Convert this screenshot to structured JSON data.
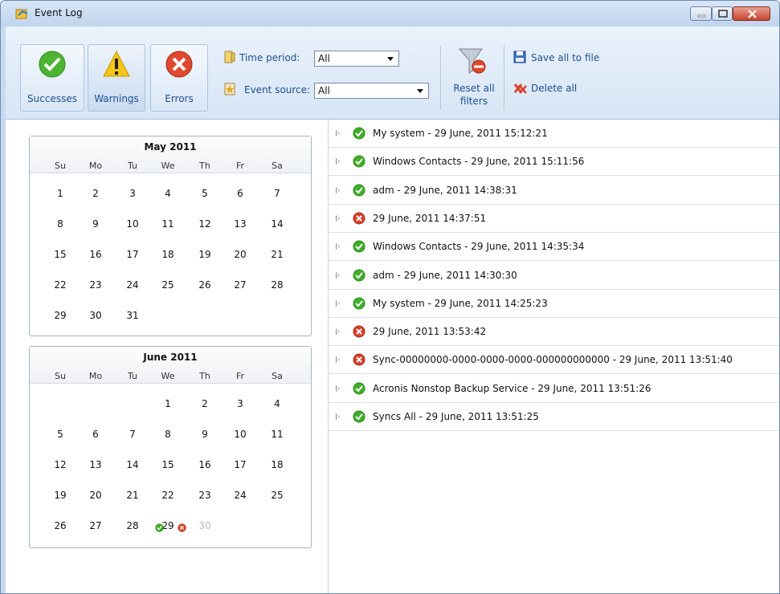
{
  "window": {
    "title": "Event Log"
  },
  "toolbar": {
    "successes_label": "Successes",
    "warnings_label": "Warnings",
    "errors_label": "Errors",
    "time_period_label": "Time period:",
    "time_period_value": "All",
    "event_source_label": "Event source:",
    "event_source_value": "All",
    "reset_line1": "Reset all",
    "reset_line2": "filters",
    "save_label": "Save all to file",
    "delete_label": "Delete all"
  },
  "calendars": [
    {
      "title": "May 2011",
      "dow": [
        "Su",
        "Mo",
        "Tu",
        "We",
        "Th",
        "Fr",
        "Sa"
      ],
      "rows": [
        [
          "1",
          "2",
          "3",
          "4",
          "5",
          "6",
          "7"
        ],
        [
          "8",
          "9",
          "10",
          "11",
          "12",
          "13",
          "14"
        ],
        [
          "15",
          "16",
          "17",
          "18",
          "19",
          "20",
          "21"
        ],
        [
          "22",
          "23",
          "24",
          "25",
          "26",
          "27",
          "28"
        ],
        [
          "29",
          "30",
          "31",
          "",
          "",
          "",
          ""
        ]
      ]
    },
    {
      "title": "June 2011",
      "dow": [
        "Su",
        "Mo",
        "Tu",
        "We",
        "Th",
        "Fr",
        "Sa"
      ],
      "rows": [
        [
          "",
          "",
          "",
          "1",
          "2",
          "3",
          "4"
        ],
        [
          "5",
          "6",
          "7",
          "8",
          "9",
          "10",
          "11"
        ],
        [
          "12",
          "13",
          "14",
          "15",
          "16",
          "17",
          "18"
        ],
        [
          "19",
          "20",
          "21",
          "22",
          "23",
          "24",
          "25"
        ],
        [
          "26",
          "27",
          "28",
          "29",
          "30",
          "",
          ""
        ]
      ]
    }
  ],
  "events": [
    {
      "status": "success",
      "text": "My system - 29 June, 2011 15:12:21"
    },
    {
      "status": "success",
      "text": "Windows Contacts - 29 June, 2011 15:11:56"
    },
    {
      "status": "success",
      "text": "adm - 29 June, 2011 14:38:31"
    },
    {
      "status": "error",
      "text": "29 June, 2011 14:37:51"
    },
    {
      "status": "success",
      "text": "Windows Contacts - 29 June, 2011 14:35:34"
    },
    {
      "status": "success",
      "text": "adm - 29 June, 2011 14:30:30"
    },
    {
      "status": "success",
      "text": "My system - 29 June, 2011 14:25:23"
    },
    {
      "status": "error",
      "text": "29 June, 2011 13:53:42"
    },
    {
      "status": "error",
      "text": "Sync-00000000-0000-0000-0000-000000000000 - 29 June, 2011 13:51:40"
    },
    {
      "status": "success",
      "text": "Acronis Nonstop Backup Service - 29 June, 2011 13:51:26"
    },
    {
      "status": "success",
      "text": "Syncs All - 29 June, 2011 13:51:25"
    }
  ],
  "colors": {
    "success": "#3fae2a",
    "error": "#d9412a",
    "warning": "#f2c21b",
    "accent": "#1d4f91"
  }
}
